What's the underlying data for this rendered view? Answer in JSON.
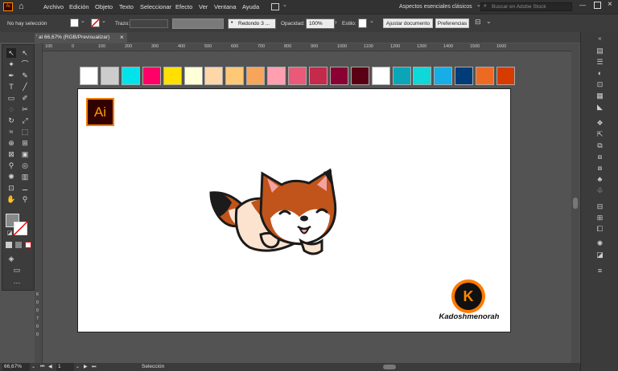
{
  "app": {
    "logo": "Ai"
  },
  "menu": [
    "Archivo",
    "Edición",
    "Objeto",
    "Texto",
    "Seleccionar",
    "Efecto",
    "Ver",
    "Ventana",
    "Ayuda"
  ],
  "workspace": "Aspectos esenciales clásicos",
  "search": {
    "placeholder": "Buscar en Adobe Stock"
  },
  "control": {
    "selection": "No hay selección",
    "stroke_label": "Trazo:",
    "brush": "Redondo 3 ...",
    "opacity_label": "Opacidad:",
    "opacity_value": "100%",
    "style_label": "Estilo:",
    "adjust_button": "Ajustar documento",
    "prefs_button": "Preferencias"
  },
  "tab": {
    "title": "' al 66,67% (RGB/Previsualizar)",
    "close": "×"
  },
  "ruler": {
    "h": [
      "100",
      "0",
      "100",
      "200",
      "300",
      "400",
      "500",
      "600",
      "700",
      "800",
      "900",
      "1000",
      "1100",
      "1200",
      "1300",
      "1400",
      "1500",
      "1600"
    ],
    "v": [
      "6",
      "0",
      "0",
      "7",
      "0",
      "0"
    ]
  },
  "swatches": [
    "#ffffff",
    "#cccccc",
    "#00e3ea",
    "#ff0066",
    "#ffe000",
    "#ffffd8",
    "#fed6a8",
    "#ffc877",
    "#f6a55a",
    "#ff9fb0",
    "#e85a77",
    "#c42a4b",
    "#8a0033",
    "#5b0014",
    "#ffffff",
    "#0aa6b8",
    "#0fd8d8",
    "#17aee8",
    "#003c78",
    "#ee6a23",
    "#d73b00"
  ],
  "artboard": {
    "logo_ai": "Ai",
    "brand_mark": "K",
    "brand_text": "Kadoshmenorah"
  },
  "status": {
    "zoom": "66,67%",
    "page": "1",
    "mode": "Selección"
  },
  "colors": {
    "fox_orange": "#c1541a",
    "fox_dark": "#1b1b1b",
    "fox_cream": "#fbe3cf",
    "fox_pink": "#f3a2a2"
  }
}
